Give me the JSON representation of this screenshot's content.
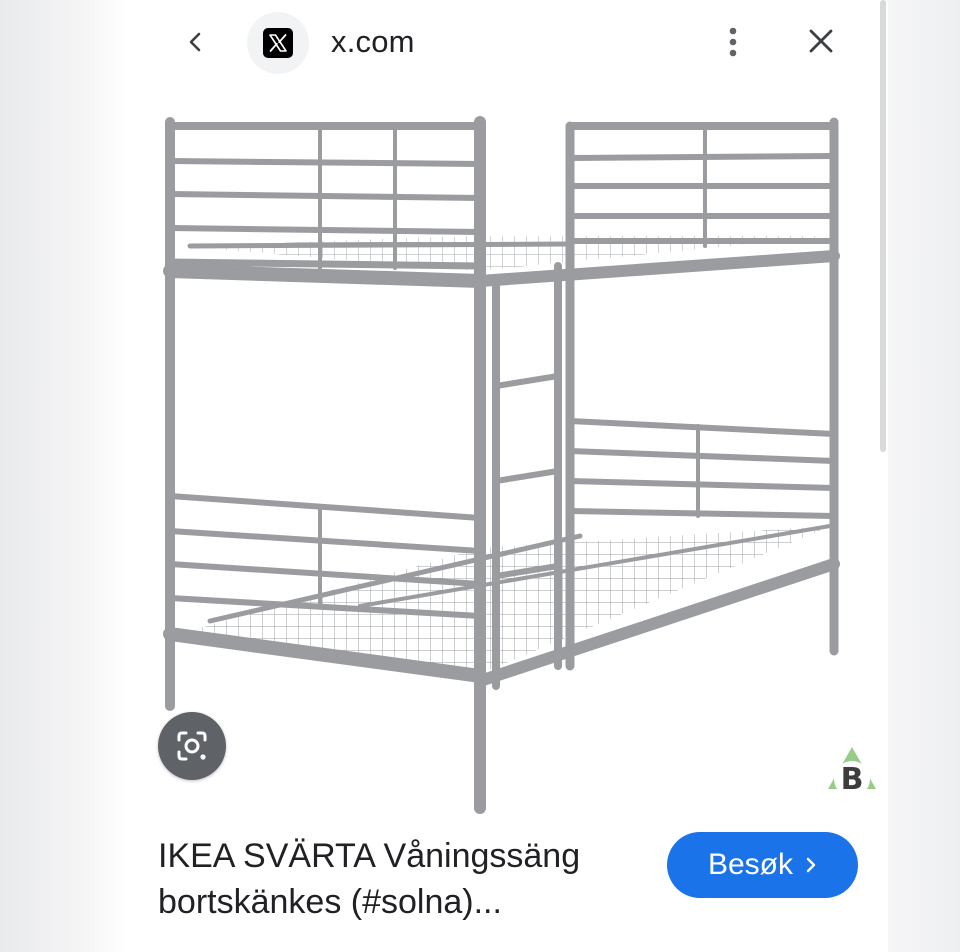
{
  "header": {
    "site_name": "x.com",
    "logo_icon": "x-logo-icon",
    "back_icon": "chevron-left-icon",
    "more_icon": "more-vertical-icon",
    "close_icon": "close-icon"
  },
  "image": {
    "lens_icon": "camera-search-icon",
    "watermark_icon": "recycle-b-badge-icon"
  },
  "result": {
    "title_line1": "IKEA SVÄRTA Våningssäng",
    "title_line2": "bortskänkes (#solna)...",
    "visit_label": "Besøk",
    "visit_icon": "chevron-right-icon",
    "accent_color": "#1a73e8"
  }
}
